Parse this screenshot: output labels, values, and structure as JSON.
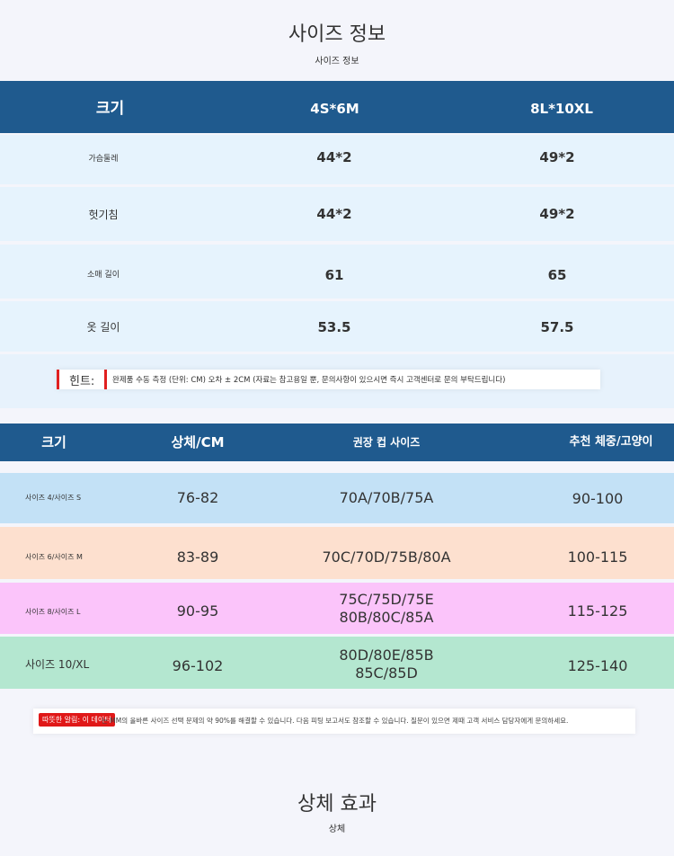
{
  "section1": {
    "title": "사이즈 정보",
    "subtitle": "사이즈 정보",
    "table": {
      "headers": [
        "크기",
        "4S*6M",
        "8L*10XL"
      ],
      "rows": [
        {
          "label": "가슴둘레",
          "v1": "44*2",
          "v2": "49*2"
        },
        {
          "label": "헛기침",
          "v1": "44*2",
          "v2": "49*2"
        },
        {
          "label": "소매 길이",
          "v1": "61",
          "v2": "65"
        },
        {
          "label": "옷 길이",
          "v1": "53.5",
          "v2": "57.5"
        }
      ]
    },
    "hint": {
      "label": "힌트:",
      "text": "완제품 수동 측정 (단위: CM) 오차 ± 2CM (자료는 참고용일 뿐, 문의사항이 있으시면 즉시 고객센터로 문의 부탁드립니다)"
    }
  },
  "section2": {
    "headers": [
      "크기",
      "상체/CM",
      "권장 컵 사이즈",
      "추천 체중/고양이"
    ],
    "rows": [
      {
        "label": "사이즈 4/사이즈 S",
        "chest": "76-82",
        "cup1": "70A/70B/75A",
        "cup2": "",
        "weight": "90-100",
        "bg": "#c3e1f6"
      },
      {
        "label": "사이즈 6/사이즈 M",
        "chest": "83-89",
        "cup1": "70C/70D/75B/80A",
        "cup2": "",
        "weight": "100-115",
        "bg": "#fde0cf"
      },
      {
        "label": "사이즈 8/사이즈 L",
        "chest": "90-95",
        "cup1": "75C/75D/75E",
        "cup2": "80B/80C/85A",
        "weight": "115-125",
        "bg": "#fbc4fa"
      },
      {
        "label": "사이즈 10/XL",
        "chest": "96-102",
        "cup1": "80D/80E/85B",
        "cup2": "85C/85D",
        "weight": "125-140",
        "bg": "#b4e7d0"
      }
    ],
    "note": {
      "tag": "따뜻한 알림: 이 데이터",
      "text": "는 MM의 올바른 사이즈 선택 문제의 약 90%를 해결할 수 있습니다. 다음 피팅 보고서도 참조할 수 있습니다. 질문이 있으면 제때 고객 서비스 담당자에게 문의하세요."
    }
  },
  "section3": {
    "title": "상체 효과",
    "subtitle": "상체"
  },
  "colors": {
    "header_blue": "#1f5a8e",
    "row_light_blue": "#e6f3fd",
    "hint_red": "#e02020"
  }
}
